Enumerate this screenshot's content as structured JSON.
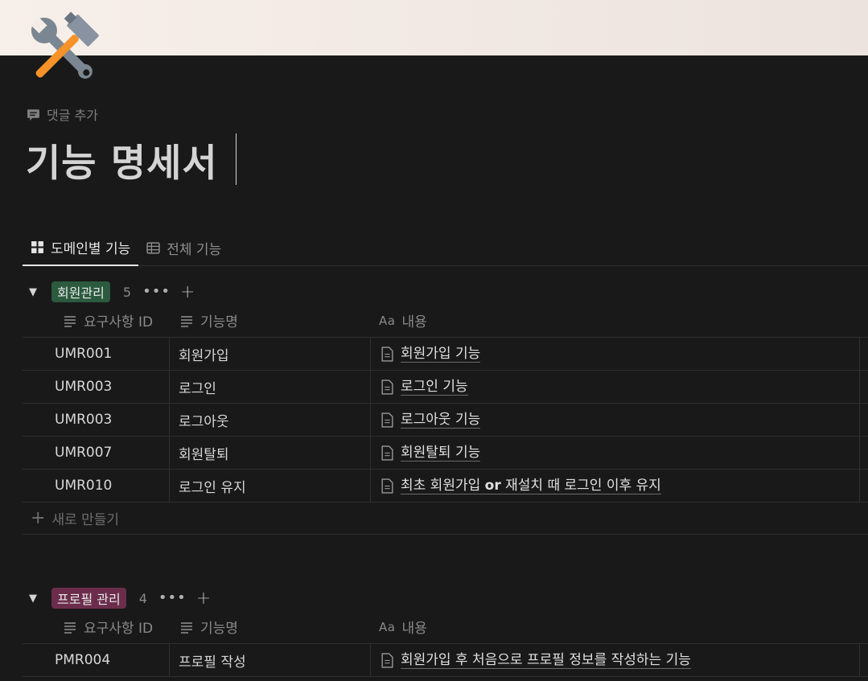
{
  "page": {
    "icon": "hammer-and-wrench-icon",
    "add_comment": "댓글 추가",
    "title": "기능 명세서"
  },
  "views": [
    {
      "label": "도메인별 기능",
      "icon": "board-icon",
      "active": true
    },
    {
      "label": "전체 기능",
      "icon": "table-icon",
      "active": false
    }
  ],
  "columns": {
    "id": "요구사항 ID",
    "name": "기능명",
    "content_prefix": "Aa",
    "content": "내용"
  },
  "groups": [
    {
      "label": "회원관리",
      "color": "#2b5a3e",
      "count": "5",
      "rows": [
        {
          "id": "UMR001",
          "name": "회원가입",
          "content": "회원가입 기능"
        },
        {
          "id": "UMR003",
          "name": "로그인",
          "content": "로그인 기능"
        },
        {
          "id": "UMR003",
          "name": "로그아웃",
          "content": "로그아웃 기능"
        },
        {
          "id": "UMR007",
          "name": "회원탈퇴",
          "content": "회원탈퇴 기능"
        },
        {
          "id": "UMR010",
          "name": "로그인 유지",
          "content_parts": [
            "최초 회원가입 ",
            "or",
            " 재설치 때 로그인 이후 유지"
          ]
        }
      ],
      "new_label": "새로 만들기"
    },
    {
      "label": "프로필 관리",
      "color": "#6b2d4b",
      "count": "4",
      "rows": [
        {
          "id": "PMR004",
          "name": "프로필 작성",
          "content": "회원가입 후 처음으로 프로필 정보를 작성하는 기능"
        }
      ]
    }
  ],
  "colors": {
    "background": "#191919",
    "text": "#d4d4d4",
    "muted": "#8a8a8a",
    "border": "#2f2f2f"
  }
}
